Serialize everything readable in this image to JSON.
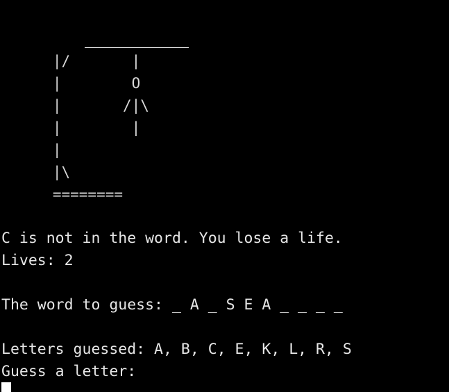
{
  "terminal": {
    "gallows": {
      "rows": [
        "      |/       |",
        "      |        O",
        "      |       /|\\",
        "      |        |",
        "      |",
        "      |\\",
        "      ========"
      ]
    },
    "messages": {
      "not_in_word": "C is not in the word. You lose a life.",
      "lives": "Lives: 2",
      "word_to_guess": "The word to guess: _ A _ S E A _ _ _ _",
      "letters_guessed": "Letters guessed: A, B, C, E, K, L, R, S",
      "prompt": "Guess a letter:"
    }
  }
}
